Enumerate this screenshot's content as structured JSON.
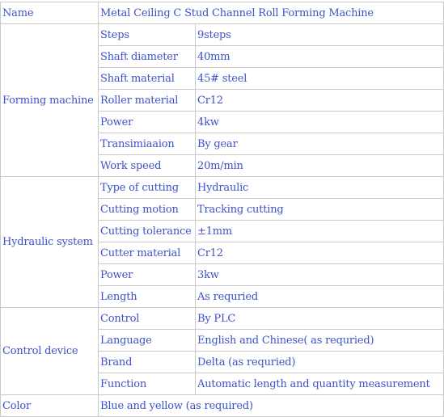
{
  "colors": {
    "text": "#3d52c8",
    "border": "#c9c9c9",
    "background": "#ffffff"
  },
  "name_row": {
    "label": "Name",
    "value": "Metal Ceiling C Stud Channel Roll Forming Machine"
  },
  "groups": [
    {
      "label": "Forming machine",
      "rows": [
        {
          "key": "Steps",
          "value": "9steps"
        },
        {
          "key": "Shaft diameter",
          "value": "40mm"
        },
        {
          "key": "Shaft material",
          "value": "45# steel"
        },
        {
          "key": "Roller material",
          "value": "Cr12"
        },
        {
          "key": "Power",
          "value": "4kw"
        },
        {
          "key": "Transimiaaion",
          "value": "By gear"
        },
        {
          "key": "Work speed",
          "value": "20m/min"
        }
      ]
    },
    {
      "label": "Hydraulic system",
      "rows": [
        {
          "key": "Type of cutting",
          "value": "Hydraulic"
        },
        {
          "key": "Cutting motion",
          "value": "Tracking cutting"
        },
        {
          "key": "Cutting tolerance",
          "value": "±1mm"
        },
        {
          "key": "Cutter material",
          "value": "Cr12"
        },
        {
          "key": "Power",
          "value": "3kw"
        },
        {
          "key": "Length",
          "value": "As requried"
        }
      ]
    },
    {
      "label": "Control device",
      "rows": [
        {
          "key": "Control",
          "value": "By PLC"
        },
        {
          "key": "Language",
          "value": "English and Chinese( as requried)"
        },
        {
          "key": "Brand",
          "value": "Delta (as requried)"
        },
        {
          "key": "Function",
          "value": "Automatic length and quantity measurement"
        }
      ]
    }
  ],
  "color_row": {
    "label": "Color",
    "value": "Blue and yellow (as required)"
  }
}
